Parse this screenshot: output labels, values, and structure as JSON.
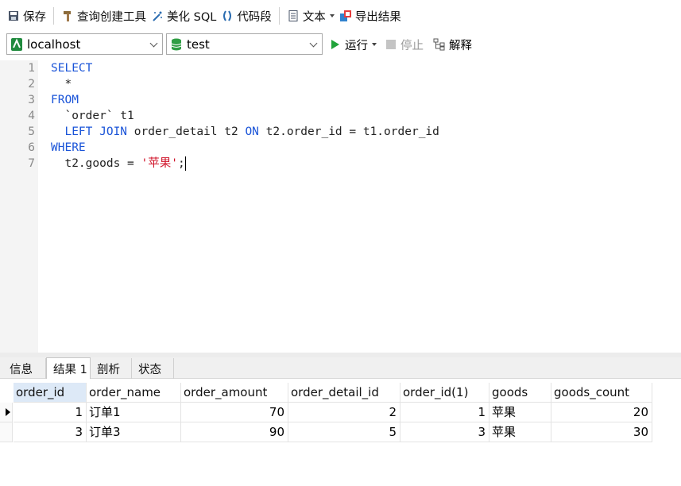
{
  "toolbar": {
    "save": "保存",
    "query_builder": "查询创建工具",
    "beautify": "美化 SQL",
    "snippet": "代码段",
    "text": "文本",
    "export": "导出结果"
  },
  "connection": {
    "server": "localhost",
    "database": "test"
  },
  "actions": {
    "run": "运行",
    "stop": "停止",
    "explain": "解释"
  },
  "editor": {
    "lines": [
      {
        "n": "1",
        "parts": [
          {
            "t": "SELECT",
            "c": "kw"
          }
        ]
      },
      {
        "n": "2",
        "parts": [
          {
            "t": "  *",
            "c": "id"
          }
        ]
      },
      {
        "n": "3",
        "parts": [
          {
            "t": "FROM",
            "c": "kw"
          }
        ]
      },
      {
        "n": "4",
        "parts": [
          {
            "t": "  `order` t1",
            "c": "id"
          }
        ]
      },
      {
        "n": "5",
        "parts": [
          {
            "t": "  LEFT JOIN",
            "c": "kw"
          },
          {
            "t": " order_detail t2 ",
            "c": "id"
          },
          {
            "t": "ON",
            "c": "kw"
          },
          {
            "t": " t2.order_id = t1.order_id",
            "c": "id"
          }
        ]
      },
      {
        "n": "6",
        "parts": [
          {
            "t": "WHERE",
            "c": "kw"
          }
        ]
      },
      {
        "n": "7",
        "parts": [
          {
            "t": "  t2.goods = ",
            "c": "id"
          },
          {
            "t": "'苹果'",
            "c": "str"
          },
          {
            "t": ";",
            "c": "id"
          }
        ]
      }
    ]
  },
  "tabs": [
    "信息",
    "结果 1",
    "剖析",
    "状态"
  ],
  "active_tab": "结果 1",
  "grid": {
    "columns": [
      "order_id",
      "order_name",
      "order_amount",
      "order_detail_id",
      "order_id(1)",
      "goods",
      "goods_count"
    ],
    "rows": [
      [
        "1",
        "订单1",
        "70",
        "2",
        "1",
        "苹果",
        "20"
      ],
      [
        "3",
        "订单3",
        "90",
        "5",
        "3",
        "苹果",
        "30"
      ]
    ]
  },
  "colors": {
    "keyword": "#1a54d8",
    "string": "#d0142a",
    "run_green": "#21a33a",
    "selected_header": "#dde9f7"
  }
}
